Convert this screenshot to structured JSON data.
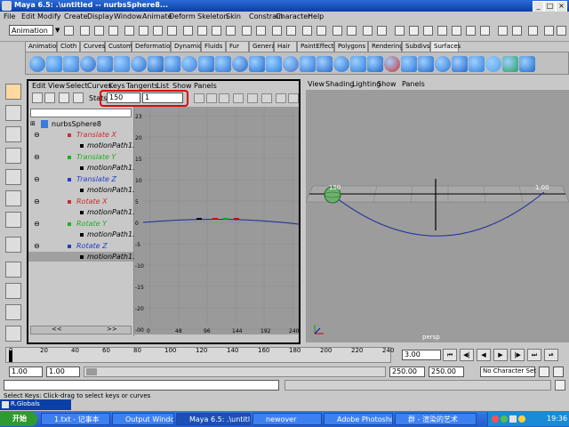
{
  "window": {
    "title": "Maya 6.5: .\\untitled -- nurbsSphere8..."
  },
  "menubar": [
    "File",
    "Edit",
    "Modify",
    "Create",
    "Display",
    "Window",
    "Animate",
    "Deform",
    "Skeleton",
    "Skin",
    "Constrain",
    "Character",
    "Help"
  ],
  "mode_select": "Animation",
  "shelf_tabs": [
    "Animation",
    "Cloth",
    "Curves",
    "Custom",
    "Deformation",
    "Dynamics",
    "Fluids",
    "Fur",
    "General",
    "Hair",
    "PaintEffects",
    "Polygons",
    "Rendering",
    "Subdivs",
    "Surfaces"
  ],
  "shelf_active_tab": "Surfaces",
  "graph_editor": {
    "menu": [
      "Edit",
      "View",
      "Select",
      "Curves",
      "Keys",
      "Tangents",
      "List",
      "Show",
      "Panels"
    ],
    "stats_label": "Stats",
    "stat_value_1": "150",
    "stat_value_2": "1",
    "outliner": {
      "root": "nurbsSphere8",
      "items": [
        {
          "label": "Translate X",
          "sub": "motionPath1.U V",
          "color": "#c83030"
        },
        {
          "label": "Translate Y",
          "sub": "motionPath1.U V",
          "color": "#20b020"
        },
        {
          "label": "Translate Z",
          "sub": "motionPath1.U V",
          "color": "#2040c8"
        },
        {
          "label": "Rotate X",
          "sub": "motionPath1.U V",
          "color": "#c83030"
        },
        {
          "label": "Rotate Y",
          "sub": "motionPath1.U V",
          "color": "#20b020"
        },
        {
          "label": "Rotate Z",
          "sub": "motionPath1.U V",
          "color": "#2040c8"
        }
      ],
      "scroll_left": "<<",
      "scroll_right": ">>"
    },
    "y_ticks": [
      "23",
      "20",
      "15",
      "10",
      "5",
      "0",
      "-5",
      "-10",
      "-15",
      "-20",
      "-00"
    ],
    "x_ticks": [
      "0",
      "48",
      "96",
      "144",
      "192",
      "240"
    ]
  },
  "viewport": {
    "menu": [
      "View",
      "Shading",
      "Lighting",
      "Show",
      "Panels"
    ],
    "label_start": "150",
    "label_end": "1.00",
    "camera": "persp"
  },
  "timeslider": {
    "ticks": [
      "0",
      "20",
      "40",
      "60",
      "80",
      "100",
      "120",
      "140",
      "160",
      "180",
      "200",
      "220",
      "240"
    ],
    "current_frame": "3.00"
  },
  "rangeslider": {
    "start": "1.00",
    "start2": "1.00",
    "end": "250.00",
    "end2": "250.00",
    "character_set": "No Character Set"
  },
  "cmdline": {
    "label": "R.Globals"
  },
  "helpline": {
    "text": "Select Keys: Click-drag to select keys or curves"
  },
  "taskbar": {
    "start": "开始",
    "items": [
      {
        "label": "1.txt - 记事本",
        "active": false
      },
      {
        "label": "Output Window",
        "active": false
      },
      {
        "label": "Maya 6.5: .\\untitle...",
        "active": true
      },
      {
        "label": "newover",
        "active": false
      },
      {
        "label": "Adobe Photoshop",
        "active": false
      },
      {
        "label": "群 - 渲染的艺术",
        "active": false
      }
    ],
    "clock": "19:36"
  }
}
